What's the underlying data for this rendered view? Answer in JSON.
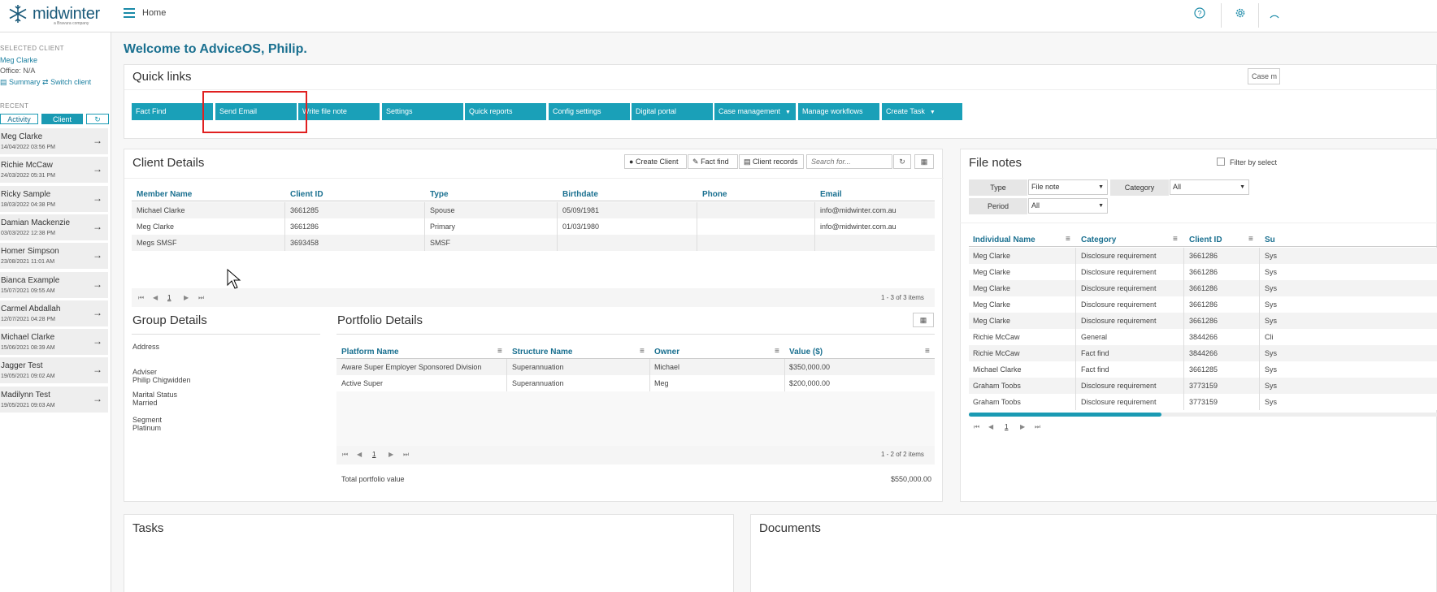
{
  "topbar": {
    "logo_text": "midwinter",
    "logo_sub": "a Bravura company",
    "breadcrumb": "Home",
    "accent": "#1aa0b8"
  },
  "sidebar": {
    "selected_client_heading": "SELECTED CLIENT",
    "client_name": "Meg Clarke",
    "office": "Office: N/A",
    "summary_link": "Summary",
    "switch_link": "Switch client",
    "recent_heading": "RECENT",
    "tab_activity": "Activity",
    "tab_client": "Client",
    "recent": [
      {
        "name": "Meg Clarke",
        "date": "14/04/2022 03:56 PM"
      },
      {
        "name": "Richie McCaw",
        "date": "24/03/2022 05:31 PM"
      },
      {
        "name": "Ricky Sample",
        "date": "18/03/2022 04:38 PM"
      },
      {
        "name": "Damian Mackenzie",
        "date": "03/03/2022 12:38 PM"
      },
      {
        "name": "Homer Simpson",
        "date": "23/08/2021 11:01 AM"
      },
      {
        "name": "Bianca Example",
        "date": "15/07/2021 09:55 AM"
      },
      {
        "name": "Carmel Abdallah",
        "date": "12/07/2021 04:28 PM"
      },
      {
        "name": "Michael Clarke",
        "date": "15/06/2021 08:39 AM"
      },
      {
        "name": "Jagger Test",
        "date": "19/05/2021 09:02 AM"
      },
      {
        "name": "Madilynn Test",
        "date": "19/05/2021 09:03 AM"
      }
    ]
  },
  "welcome": "Welcome to AdviceOS, Philip.",
  "quick_links": {
    "title": "Quick links",
    "case_select": "Case m",
    "buttons": [
      "Fact Find",
      "Send Email",
      "Write file note",
      "Settings",
      "Quick reports",
      "Config settings",
      "Digital portal",
      "Case management",
      "Manage workflows",
      "Create Task"
    ]
  },
  "client_details": {
    "title": "Client Details",
    "create_client": "Create Client",
    "fact_find": "Fact find",
    "client_records": "Client records",
    "search_placeholder": "Search for...",
    "columns": [
      "Member Name",
      "Client ID",
      "Type",
      "Birthdate",
      "Phone",
      "Email"
    ],
    "rows": [
      [
        "Michael Clarke",
        "3661285",
        "Spouse",
        "05/09/1981",
        "",
        "info@midwinter.com.au"
      ],
      [
        "Meg Clarke",
        "3661286",
        "Primary",
        "01/03/1980",
        "",
        "info@midwinter.com.au"
      ],
      [
        "Megs SMSF",
        "3693458",
        "SMSF",
        "",
        "",
        ""
      ]
    ],
    "page": "1",
    "count": "1 - 3 of 3 items"
  },
  "group_details": {
    "title": "Group Details",
    "address_label": "Address",
    "adviser_label": "Adviser",
    "adviser": "Philip Chigwidden",
    "marital_label": "Marital Status",
    "marital": "Married",
    "segment_label": "Segment",
    "segment": "Platinum"
  },
  "portfolio": {
    "title": "Portfolio Details",
    "columns": [
      "Platform Name",
      "Structure Name",
      "Owner",
      "Value ($)"
    ],
    "rows": [
      [
        "Aware Super Employer Sponsored Division",
        "Superannuation",
        "Michael",
        "$350,000.00"
      ],
      [
        "Active Super",
        "Superannuation",
        "Meg",
        "$200,000.00"
      ]
    ],
    "page": "1",
    "count": "1 - 2 of 2 items",
    "total_label": "Total portfolio value",
    "total": "$550,000.00"
  },
  "file_notes": {
    "title": "File notes",
    "filter_label": "Filter by select",
    "type_label": "Type",
    "type_value": "File note",
    "category_label": "Category",
    "category_value": "All",
    "period_label": "Period",
    "period_value": "All",
    "columns": [
      "Individual Name",
      "Category",
      "Client ID",
      "Su"
    ],
    "rows": [
      [
        "Meg Clarke",
        "Disclosure requirement",
        "3661286",
        "Sys"
      ],
      [
        "Meg Clarke",
        "Disclosure requirement",
        "3661286",
        "Sys"
      ],
      [
        "Meg Clarke",
        "Disclosure requirement",
        "3661286",
        "Sys"
      ],
      [
        "Meg Clarke",
        "Disclosure requirement",
        "3661286",
        "Sys"
      ],
      [
        "Meg Clarke",
        "Disclosure requirement",
        "3661286",
        "Sys"
      ],
      [
        "Richie McCaw",
        "General",
        "3844266",
        "Cli"
      ],
      [
        "Richie McCaw",
        "Fact find",
        "3844266",
        "Sys"
      ],
      [
        "Michael Clarke",
        "Fact find",
        "3661285",
        "Sys"
      ],
      [
        "Graham Toobs",
        "Disclosure requirement",
        "3773159",
        "Sys"
      ],
      [
        "Graham Toobs",
        "Disclosure requirement",
        "3773159",
        "Sys"
      ]
    ],
    "page": "1"
  },
  "bottom": {
    "tasks_title": "Tasks",
    "documents_title": "Documents"
  }
}
